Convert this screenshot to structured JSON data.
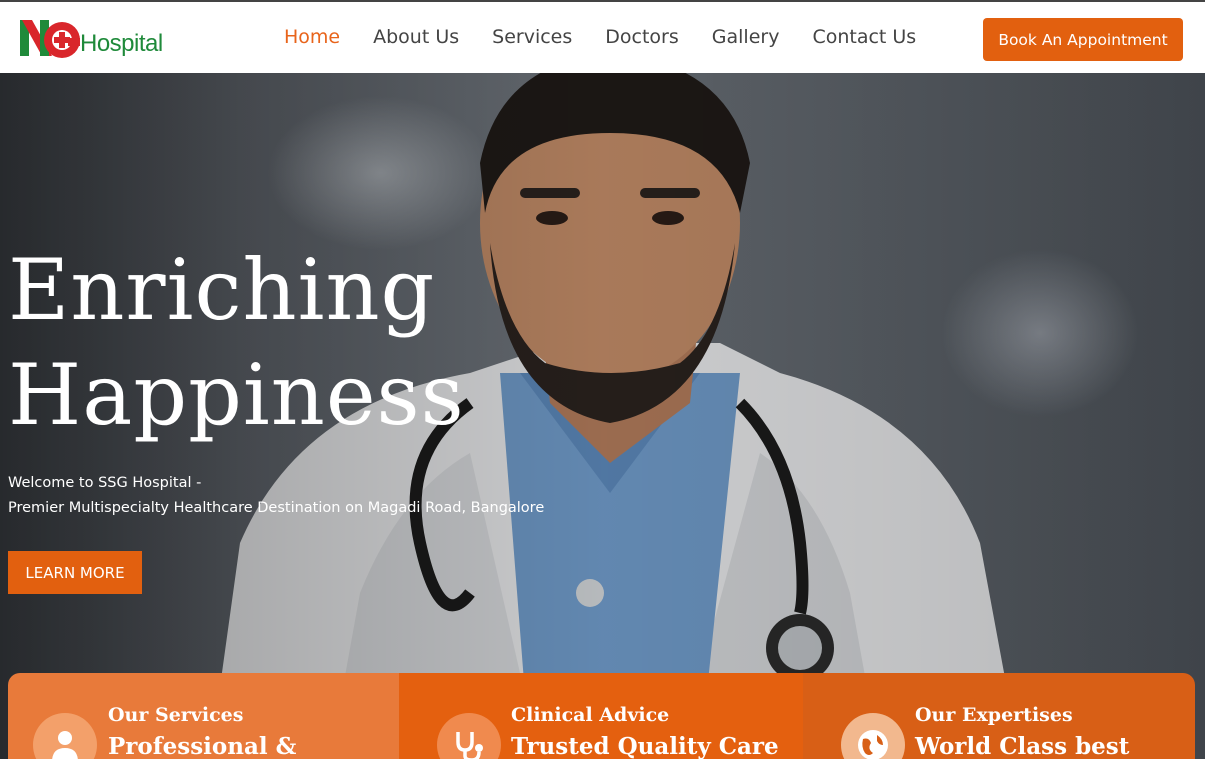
{
  "brand": {
    "logo_text": "Hospital",
    "accent": "#e2600f",
    "logo_green": "#1f8a3a",
    "logo_red": "#d9262b"
  },
  "nav": {
    "items": [
      {
        "label": "Home",
        "active": true
      },
      {
        "label": "About Us",
        "active": false
      },
      {
        "label": "Services",
        "active": false
      },
      {
        "label": "Doctors",
        "active": false
      },
      {
        "label": "Gallery",
        "active": false
      },
      {
        "label": "Contact Us",
        "active": false
      }
    ],
    "cta_label": "Book An Appointment"
  },
  "hero": {
    "title_line1": "Enriching",
    "title_line2": "Happiness",
    "subtitle_line1": "Welcome to SSG Hospital -",
    "subtitle_line2": "Premier Multispecialty Healthcare Destination on Magadi Road, Bangalore",
    "button_label": "LEARN MORE"
  },
  "features": [
    {
      "label": "Our Services",
      "heading": "Professional &",
      "icon": "doctor-icon"
    },
    {
      "label": "Clinical Advice",
      "heading": "Trusted Quality Care",
      "icon": "stethoscope-icon"
    },
    {
      "label": "Our Expertises",
      "heading": "World Class best",
      "icon": "globe-icon"
    }
  ]
}
